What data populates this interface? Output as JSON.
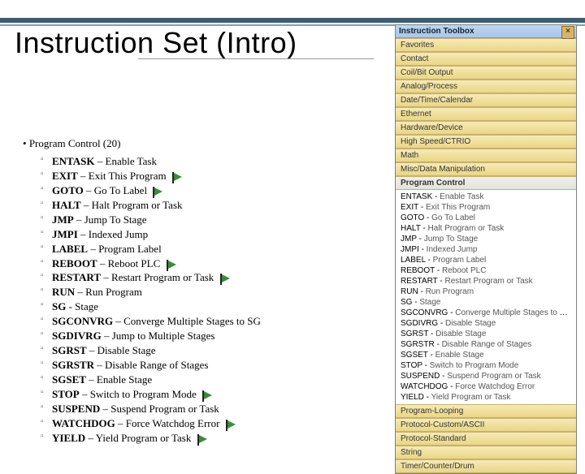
{
  "title": "Instruction Set (Intro)",
  "lead": "Program Control (20)",
  "items": [
    {
      "m": "ENTASK",
      "d": "Enable Task",
      "flag": false
    },
    {
      "m": "EXIT",
      "d": "Exit This Program",
      "flag": true
    },
    {
      "m": "GOTO",
      "d": "Go To Label",
      "flag": true
    },
    {
      "m": "HALT",
      "d": "Halt Program or Task",
      "flag": false
    },
    {
      "m": "JMP",
      "d": "Jump To Stage",
      "flag": false
    },
    {
      "m": "JMPI",
      "d": "Indexed Jump",
      "flag": false
    },
    {
      "m": "LABEL",
      "d": "Program Label",
      "flag": false
    },
    {
      "m": "REBOOT",
      "d": "Reboot PLC",
      "flag": true
    },
    {
      "m": "RESTART",
      "d": "Restart Program or Task",
      "flag": true
    },
    {
      "m": "RUN",
      "d": "Run Program",
      "flag": false
    },
    {
      "m": "SG",
      "d": "Stage",
      "sep": "-",
      "flag": false
    },
    {
      "m": "SGCONVRG",
      "d": "Converge Multiple Stages to SG",
      "flag": false
    },
    {
      "m": "SGDIVRG",
      "d": "Jump to Multiple Stages",
      "flag": false
    },
    {
      "m": "SGRST",
      "d": "Disable Stage",
      "flag": false
    },
    {
      "m": "SGRSTR",
      "d": "Disable Range of Stages",
      "flag": false
    },
    {
      "m": "SGSET",
      "d": "Enable Stage",
      "flag": false
    },
    {
      "m": "STOP",
      "d": "Switch to Program Mode",
      "flag": true
    },
    {
      "m": "SUSPEND",
      "d": "Suspend Program or Task",
      "flag": false
    },
    {
      "m": "WATCHDOG",
      "d": "Force Watchdog Error",
      "flag": true
    },
    {
      "m": "YIELD",
      "d": "Yield Program or Task",
      "flag": true
    }
  ],
  "toolbox": {
    "title": "Instruction Toolbox",
    "close": "×",
    "groups_before": [
      "Favorites",
      "Contact",
      "Coil/Bit Output",
      "Analog/Process",
      "Date/Time/Calendar",
      "Ethernet",
      "Hardware/Device",
      "High Speed/CTRIO",
      "Math",
      "Misc/Data Manipulation"
    ],
    "open_group": "Program Control",
    "rows": [
      {
        "m": "ENTASK",
        "d": "Enable Task"
      },
      {
        "m": "EXIT",
        "d": "Exit This Program"
      },
      {
        "m": "GOTO",
        "d": "Go To Label"
      },
      {
        "m": "HALT",
        "d": "Halt Program or Task"
      },
      {
        "m": "JMP",
        "d": "Jump To Stage"
      },
      {
        "m": "JMPI",
        "d": "Indexed Jump"
      },
      {
        "m": "LABEL",
        "d": "Program Label"
      },
      {
        "m": "REBOOT",
        "d": "Reboot PLC"
      },
      {
        "m": "RESTART",
        "d": "Restart Program or Task"
      },
      {
        "m": "RUN",
        "d": "Run Program"
      },
      {
        "m": "SG",
        "d": "Stage"
      },
      {
        "m": "SGCONVRG",
        "d": "Converge Multiple Stages to SG"
      },
      {
        "m": "SGDIVRG",
        "d": "Disable Stage"
      },
      {
        "m": "SGRST",
        "d": "Disable Stage"
      },
      {
        "m": "SGRSTR",
        "d": "Disable Range of Stages"
      },
      {
        "m": "SGSET",
        "d": "Enable Stage"
      },
      {
        "m": "STOP",
        "d": "Switch to Program Mode"
      },
      {
        "m": "SUSPEND",
        "d": "Suspend Program or Task"
      },
      {
        "m": "WATCHDOG",
        "d": "Force Watchdog Error"
      },
      {
        "m": "YIELD",
        "d": "Yield Program or Task"
      }
    ],
    "groups_after": [
      "Program-Looping",
      "Protocol-Custom/ASCII",
      "Protocol-Standard",
      "String",
      "Timer/Counter/Drum"
    ]
  }
}
